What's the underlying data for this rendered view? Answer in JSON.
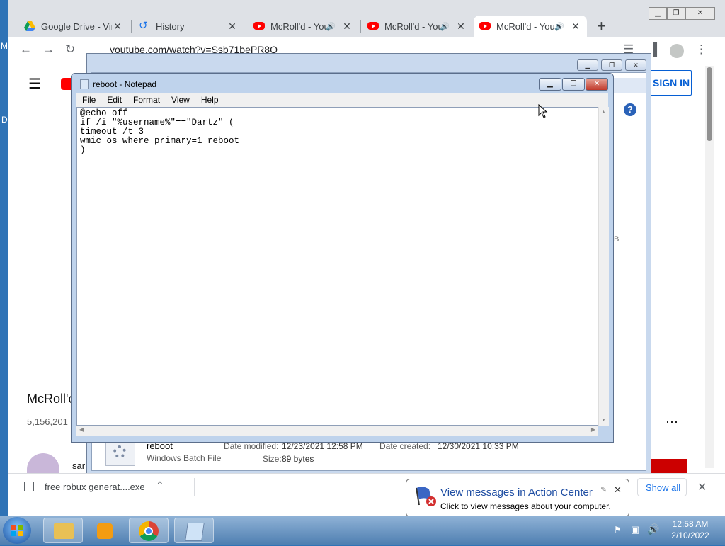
{
  "chrome": {
    "tabs": [
      {
        "label": "Google Drive - Vir",
        "icon": "google-drive-icon"
      },
      {
        "label": "History",
        "icon": "history-icon"
      },
      {
        "label": "McRoll'd - You",
        "icon": "youtube-icon"
      },
      {
        "label": "McRoll'd - You",
        "icon": "youtube-icon"
      },
      {
        "label": "McRoll'd - You",
        "icon": "youtube-icon",
        "active": true
      }
    ],
    "new_tab": "+",
    "url": "youtube.com/watch?v=Ssb71bePR8Q"
  },
  "youtube": {
    "sign_in": "SIGN IN",
    "video_title": "McRoll'c",
    "views": "5,156,201",
    "comment_user": "sar",
    "more": "⋯",
    "size_badge": "B"
  },
  "explorer": {
    "file_name": "reboot",
    "file_type": "Windows Batch File",
    "date_modified_label": "Date modified:",
    "date_modified": "12/23/2021 12:58 PM",
    "date_created_label": "Date created:",
    "date_created": "12/30/2021 10:33 PM",
    "size_label": "Size:",
    "size": "89 bytes"
  },
  "notepad": {
    "title": "reboot - Notepad",
    "menu": [
      "File",
      "Edit",
      "Format",
      "View",
      "Help"
    ],
    "content": "@echo off\nif /i \"%username%\"==\"Dartz\" (\ntimeout /t 3\nwmic os where primary=1 reboot\n)"
  },
  "download": {
    "file": "free robux generat....exe",
    "show_all": "Show all"
  },
  "balloon": {
    "title": "View messages in Action Center",
    "text": "Click to view messages about your computer."
  },
  "clock": {
    "time": "12:58 AM",
    "date": "2/10/2022"
  },
  "desktop": {
    "left_letters_1": "M",
    "left_letters_2": "D"
  }
}
